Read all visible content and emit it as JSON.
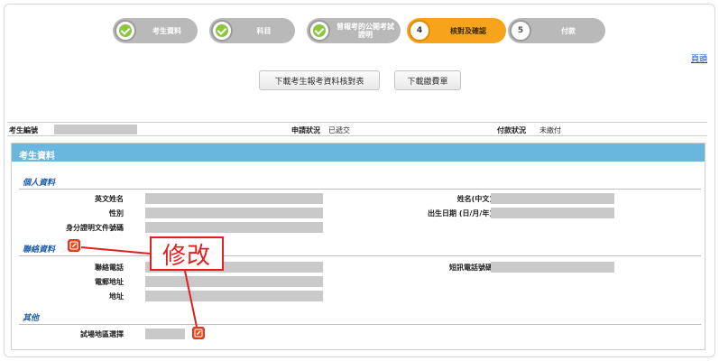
{
  "stepper": {
    "steps": [
      {
        "label": "考生資料",
        "state": "done",
        "icon": "check-icon"
      },
      {
        "label": "科目",
        "state": "done",
        "icon": "check-icon"
      },
      {
        "label": "曾報考的公開考試證明",
        "state": "done",
        "icon": "check-icon"
      },
      {
        "label": "核對及確認",
        "state": "active",
        "number": "4"
      },
      {
        "label": "付款",
        "state": "pending",
        "number": "5"
      }
    ]
  },
  "header": {
    "close_link": "頁頭",
    "download_form_label": "下載考生報考資料核對表",
    "download_receipt_label": "下載繳費單"
  },
  "status": {
    "candidate_no_label": "考生編號",
    "application_status_label": "申請狀況",
    "application_status_value": "已遞交",
    "payment_status_label": "付款狀況",
    "payment_status_value": "未繳付"
  },
  "panel": {
    "title": "考生資料",
    "personal": {
      "title": "個人資料",
      "english_name_label": "英文姓名",
      "gender_label": "性別",
      "id_doc_label": "身分證明文件號碼",
      "chinese_name_label": "姓名(中文)",
      "dob_label": "出生日期 (日/月/年)"
    },
    "contact": {
      "title": "聯絡資料",
      "phone_label": "聯絡電話",
      "email_label": "電郵地址",
      "address_label": "地址",
      "sms_label": "短訊電話號碼"
    },
    "other": {
      "title": "其他",
      "venue_label": "試場地區選擇"
    }
  },
  "annotation": {
    "callout_text": "修改"
  },
  "colors": {
    "accent": "#f6a41c",
    "header_blue": "#69b7df",
    "callout_red": "#e02020"
  }
}
